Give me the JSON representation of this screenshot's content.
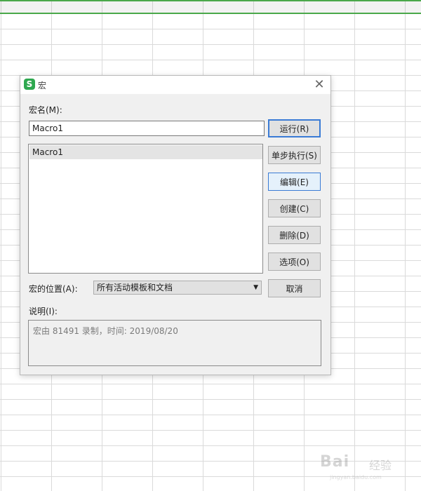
{
  "dialog": {
    "title": "宏",
    "app_icon_glyph": "S",
    "close_glyph": "✕",
    "macro_name_label": "宏名(M):",
    "macro_name_value": "Macro1",
    "macro_list": [
      {
        "name": "Macro1",
        "selected": true
      }
    ],
    "buttons": {
      "run": "运行(R)",
      "step": "单步执行(S)",
      "edit": "编辑(E)",
      "create": "创建(C)",
      "delete": "删除(D)",
      "options": "选项(O)",
      "cancel": "取消"
    },
    "location_label": "宏的位置(A):",
    "location_value": "所有活动模板和文档",
    "description_label": "说明(I):",
    "description_value": "宏由 81491 录制，时间: 2019/08/20"
  },
  "watermark": {
    "text": "Bai",
    "sub": "经验",
    "url": "jingyan.baidu.com"
  },
  "colors": {
    "accent": "#3a7bd5",
    "app_icon": "#2ea84f",
    "sheet_accent": "#4aa84a"
  }
}
